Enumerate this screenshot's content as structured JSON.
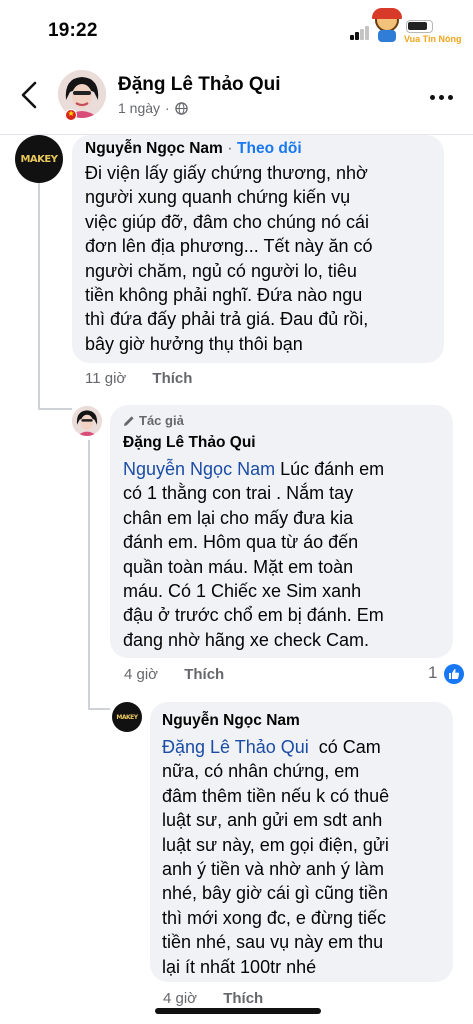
{
  "status_bar": {
    "time": "19:22",
    "watermark_text": "Vua Tin Nóng"
  },
  "header": {
    "title": "Đặng Lê Thảo Qui",
    "meta_time": "1 ngày",
    "meta_sep": "·"
  },
  "comments": [
    {
      "author": "Nguyễn Ngọc Nam",
      "follow_sep": "·",
      "follow_label": "Theo dõi",
      "lines": [
        "Đi viện lấy giấy chứng thương, nhờ",
        "người xung quanh chứng kiến vụ",
        "việc giúp đỡ, đâm cho chúng nó cái",
        "đơn lên địa phương... Tết này ăn có",
        "người chăm, ngủ có người lo, tiêu",
        "tiền không phải nghĩ. Đứa nào ngu",
        "thì đứa đấy phải trả giá. Đau đủ rồi,",
        "bây giờ hưởng thụ thôi bạn"
      ],
      "time": "11 giờ",
      "like_label": "Thích"
    },
    {
      "badge": "Tác giả",
      "author": "Đặng Lê Thảo Qui",
      "mention": "Nguyễn Ngọc Nam",
      "first_line_rest": " Lúc đánh em",
      "lines": [
        "có 1 thằng con trai . Nắm tay",
        "chân em lại cho mấy đưa kia",
        "đánh em. Hôm qua từ áo đến",
        "quần toàn máu. Mặt em toàn",
        "máu. Có 1 Chiếc xe Sim xanh",
        "đậu ở trước chổ em bị đánh. Em",
        "đang nhờ hãng xe check Cam."
      ],
      "time": "4 giờ",
      "like_label": "Thích",
      "reaction_count": "1"
    },
    {
      "author": "Nguyễn Ngọc Nam",
      "mention": "Đặng Lê Thảo Qui",
      "first_line_rest": "  có Cam",
      "lines": [
        "nữa, có nhân chứng, em",
        "đâm thêm tiền nếu k có thuê",
        "luật sư, anh gửi em sdt anh",
        "luật sư này, em gọi điện, gửi",
        "anh ý tiền và nhờ anh ý làm",
        "nhé, bây giờ cái gì cũng tiền",
        "thì mới xong đc, e đừng tiếc",
        "tiền nhé, sau vụ này em thu",
        "lại ít nhất 100tr nhé"
      ],
      "time": "4 giờ",
      "like_label": "Thích"
    }
  ],
  "avatar_logo_text": "MAKEY",
  "colors": {
    "link": "#1877f2",
    "mention": "#1b4ca6",
    "bubble": "#f0f2f5",
    "secondary_text": "#65676b"
  },
  "icons": [
    "back-arrow-icon",
    "globe-icon",
    "more-icon",
    "pencil-icon",
    "like-icon",
    "signal-icon"
  ]
}
